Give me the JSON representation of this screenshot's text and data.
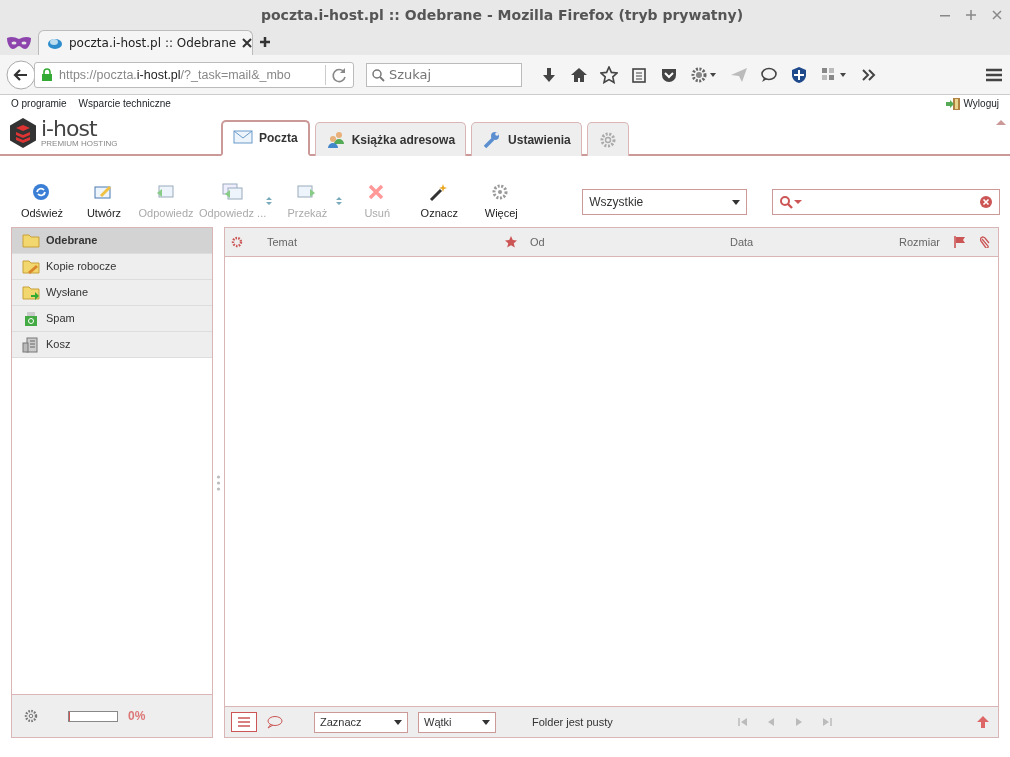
{
  "window": {
    "title": "poczta.i-host.pl :: Odebrane - Mozilla Firefox (tryb prywatny)"
  },
  "browser": {
    "tabs": [
      {
        "label": "poczta.i-host.pl :: Odebrane",
        "selected": true
      }
    ],
    "url_host_prefix": "https://poczta.",
    "url_host": "i-host.pl",
    "url_rest": "/?_task=mail&_mbo",
    "search": {
      "placeholder": "Szukaj"
    }
  },
  "top_links": [
    "O programie",
    "Wsparcie techniczne"
  ],
  "logout": "Wyloguj",
  "logo": {
    "name": "i-host",
    "tagline": "PREMIUM HOSTING"
  },
  "app_tabs": [
    {
      "kind": "mail",
      "label": "Poczta",
      "selected": true
    },
    {
      "kind": "contacts",
      "label": "Książka adresowa",
      "selected": false
    },
    {
      "kind": "settings",
      "label": "Ustawienia",
      "selected": false
    },
    {
      "kind": "gear",
      "selected": false
    }
  ],
  "toolbar": [
    {
      "kind": "refresh",
      "label": "Odśwież",
      "disabled": false,
      "menu": false
    },
    {
      "kind": "compose",
      "label": "Utwórz",
      "disabled": false,
      "menu": false
    },
    {
      "kind": "reply",
      "label": "Odpowiedz",
      "disabled": true,
      "menu": false
    },
    {
      "kind": "replyall",
      "label": "Odpowiedz ...",
      "disabled": true,
      "menu": true
    },
    {
      "kind": "forward",
      "label": "Przekaż",
      "disabled": true,
      "menu": true
    },
    {
      "kind": "delete",
      "label": "Usuń",
      "disabled": true,
      "menu": false
    },
    {
      "kind": "mark",
      "label": "Oznacz",
      "disabled": false,
      "menu": false
    },
    {
      "kind": "more",
      "label": "Więcej",
      "disabled": false,
      "menu": false
    }
  ],
  "filter": {
    "value": "Wszystkie"
  },
  "folders": [
    {
      "kind": "inbox",
      "label": "Odebrane",
      "selected": true
    },
    {
      "kind": "drafts",
      "label": "Kopie robocze",
      "selected": false
    },
    {
      "kind": "sent",
      "label": "Wysłane",
      "selected": false
    },
    {
      "kind": "spam",
      "label": "Spam",
      "selected": false
    },
    {
      "kind": "trash",
      "label": "Kosz",
      "selected": false
    }
  ],
  "quota": {
    "level": 0,
    "reading": "0%"
  },
  "columns": [
    "Temat",
    "Od",
    "Data",
    "Rozmiar"
  ],
  "footer": {
    "select": "Zaznacz",
    "threads": "Wątki",
    "status": "Folder jest pusty"
  }
}
